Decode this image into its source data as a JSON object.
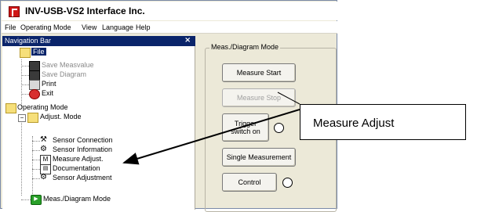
{
  "window": {
    "title": "INV-USB-VS2 Interface Inc."
  },
  "menubar": {
    "items": [
      "File",
      "Operating Mode",
      "View",
      "Language",
      "Help"
    ]
  },
  "nav": {
    "header": "Navigation Bar",
    "close": "×",
    "items": [
      {
        "label": "File",
        "selected": true
      },
      {
        "label": "Save Measvalue",
        "disabled": true
      },
      {
        "label": "Save Diagram",
        "disabled": true
      },
      {
        "label": "Print"
      },
      {
        "label": "Exit"
      },
      {
        "label": "Operating Mode"
      },
      {
        "label": "Adjust. Mode"
      },
      {
        "label": "Sensor Connection"
      },
      {
        "label": "Sensor Information"
      },
      {
        "label": "Measure Adjust."
      },
      {
        "label": "Documentation"
      },
      {
        "label": "Sensor Adjustment"
      },
      {
        "label": "Meas./Diagram Mode"
      }
    ]
  },
  "main": {
    "group_label": "Meas./Diagram Mode",
    "buttons": {
      "measure_start": "Measure Start",
      "measure_stop": "Measure Stop",
      "trigger_line1": "Trigger",
      "trigger_line2": "switch on",
      "single_measurement": "Single Measurement",
      "control": "Control"
    }
  },
  "callout": {
    "text": "Measure Adjust"
  },
  "colors": {
    "nav_header": "#0a246a",
    "selected": "#0a246a",
    "window_bg": "#ece9d8"
  }
}
